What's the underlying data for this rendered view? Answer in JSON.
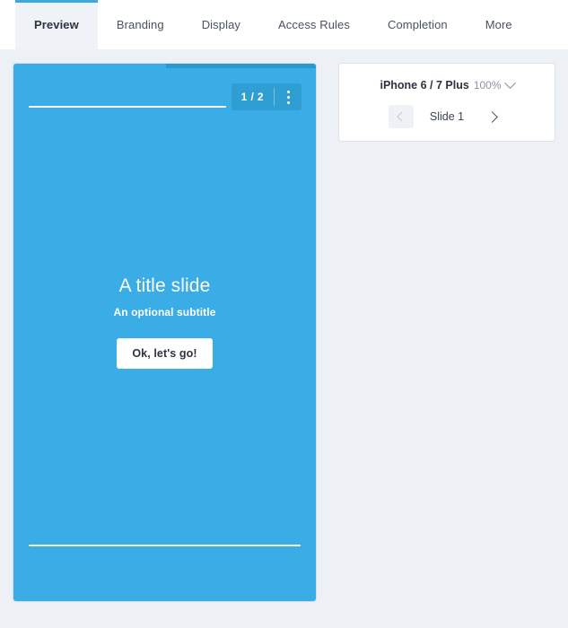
{
  "tabs": [
    {
      "label": "Preview",
      "active": true
    },
    {
      "label": "Branding",
      "active": false
    },
    {
      "label": "Display",
      "active": false
    },
    {
      "label": "Access Rules",
      "active": false
    },
    {
      "label": "Completion",
      "active": false
    },
    {
      "label": "More",
      "active": false
    }
  ],
  "preview": {
    "counter": "1 / 2",
    "menu_icon": "kebab-menu-icon",
    "title": "A title slide",
    "subtitle": "An optional subtitle",
    "cta_label": "Ok, let's go!",
    "background_color": "#3aade6",
    "topbar_color": "#2e97cc",
    "controls_color": "#2f9ed3"
  },
  "panel": {
    "device_name": "iPhone 6 / 7 Plus",
    "zoom": "100%",
    "dropdown_icon": "chevron-down-icon",
    "prev_icon": "chevron-left-icon",
    "next_icon": "chevron-right-icon",
    "slide_label": "Slide 1"
  },
  "theme": {
    "page_background": "#edf0f5",
    "accent": "#3aa9e0",
    "active_tab_background": "#eff2f6"
  }
}
